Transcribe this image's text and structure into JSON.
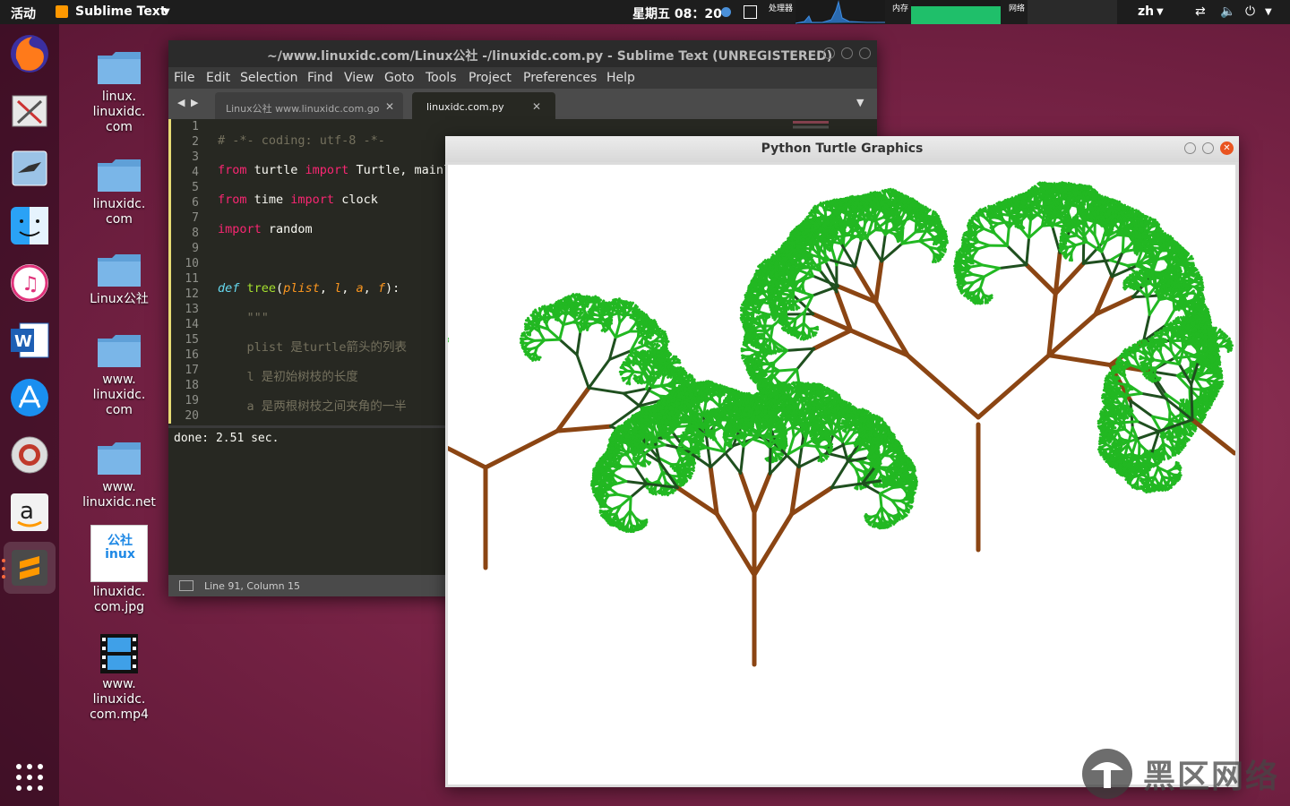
{
  "topbar": {
    "activities": "活动",
    "app_name": "Sublime Text",
    "clock": "星期五 08：20",
    "cpu_label": "处理器",
    "mem_label": "内存",
    "net_label": "网络",
    "lang": "zh"
  },
  "dock": [
    {
      "icon": "firefox-icon"
    },
    {
      "icon": "screenshot-icon"
    },
    {
      "icon": "shotwell-icon"
    },
    {
      "icon": "finder-icon"
    },
    {
      "icon": "itunes-icon"
    },
    {
      "icon": "word-icon"
    },
    {
      "icon": "app-store-icon"
    },
    {
      "icon": "help-icon"
    },
    {
      "icon": "amazon-icon"
    },
    {
      "icon": "sublime-icon"
    }
  ],
  "desktop": {
    "icons": [
      {
        "label": "linux.\nlinuxidc.\ncom"
      },
      {
        "label": "linuxidc.\ncom"
      },
      {
        "label": "Linux公社"
      },
      {
        "label": "www.\nlinuxidc.\ncom"
      },
      {
        "label": "www.\nlinuxidc.net"
      },
      {
        "label": "linuxidc.\ncom.jpg",
        "image_text": "公社 inux"
      },
      {
        "label": "www.\nlinuxidc.\ncom.mp4"
      }
    ]
  },
  "sublime": {
    "title": "~/www.linuxidc.com/Linux公社 -/linuxidc.com.py - Sublime Text (UNREGISTERED)",
    "menu": [
      "File",
      "Edit",
      "Selection",
      "Find",
      "View",
      "Goto",
      "Tools",
      "Project",
      "Preferences",
      "Help"
    ],
    "tabs": [
      {
        "label": "Linux公社 www.linuxidc.com.go"
      },
      {
        "label": "linuxidc.com.py"
      }
    ],
    "line_numbers": [
      "1",
      "2",
      "3",
      "4",
      "5",
      "6",
      "7",
      "8",
      "9",
      "10",
      "11",
      "12",
      "13",
      "14",
      "15",
      "16",
      "17",
      "18",
      "19",
      "20"
    ],
    "console": "done: 2.51 sec.",
    "status": "Line 91, Column 15"
  },
  "turtle": {
    "title": "Python Turtle Graphics"
  },
  "watermark": {
    "text": "黑区网络"
  }
}
